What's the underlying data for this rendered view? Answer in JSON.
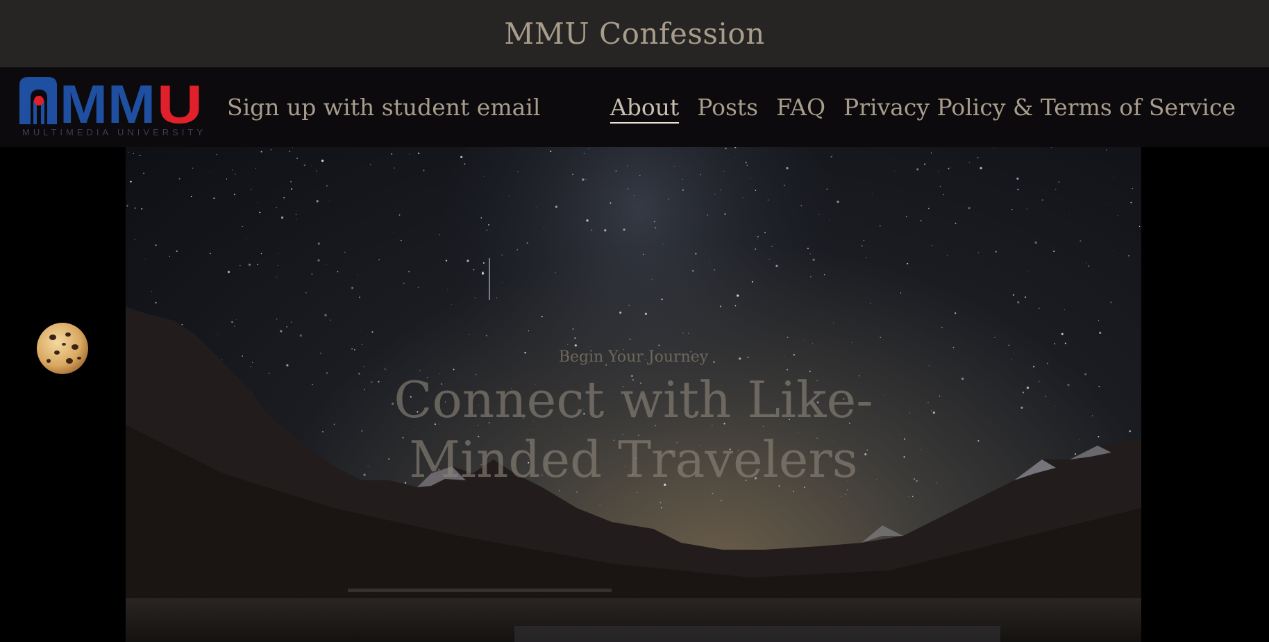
{
  "header": {
    "site_title": "MMU Confession"
  },
  "nav": {
    "logo_text": "MMU",
    "logo_subtext": "MULTIMEDIA UNIVERSITY",
    "signup_label": "Sign up with student email",
    "links": [
      {
        "label": "About",
        "active": true
      },
      {
        "label": "Posts",
        "active": false
      },
      {
        "label": "FAQ",
        "active": false
      },
      {
        "label": "Privacy Policy & Terms of Service",
        "active": false
      }
    ]
  },
  "hero": {
    "kicker": "Begin Your Journey",
    "heading": "Connect with Like-Minded Travelers"
  },
  "widgets": {
    "cookie_icon": "cookie-icon"
  },
  "colors": {
    "top_bar": "#262523",
    "nav_bar": "#0c0a0c",
    "text": "#a89d8c",
    "logo_blue": "#1f4fa0",
    "logo_red": "#e0202a"
  }
}
